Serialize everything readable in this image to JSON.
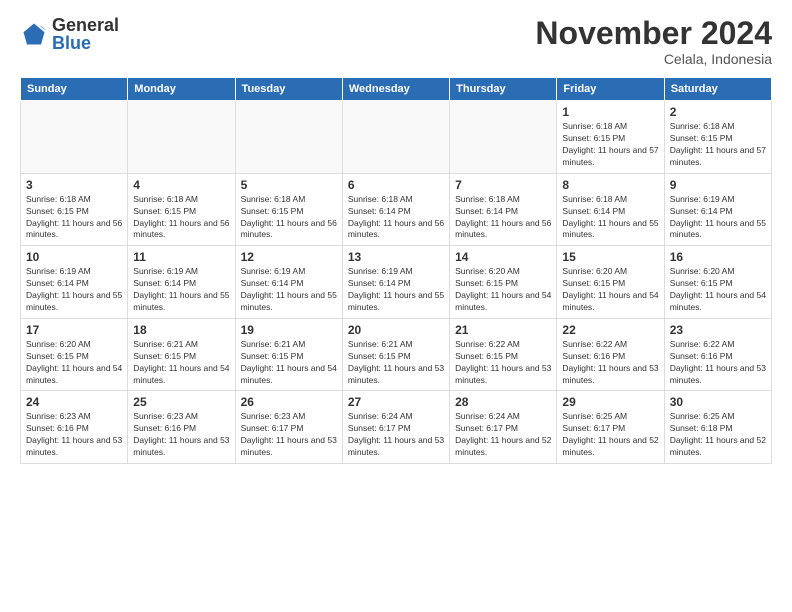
{
  "logo": {
    "general": "General",
    "blue": "Blue"
  },
  "title": "November 2024",
  "subtitle": "Celala, Indonesia",
  "days_of_week": [
    "Sunday",
    "Monday",
    "Tuesday",
    "Wednesday",
    "Thursday",
    "Friday",
    "Saturday"
  ],
  "weeks": [
    [
      {
        "day": "",
        "info": ""
      },
      {
        "day": "",
        "info": ""
      },
      {
        "day": "",
        "info": ""
      },
      {
        "day": "",
        "info": ""
      },
      {
        "day": "",
        "info": ""
      },
      {
        "day": "1",
        "info": "Sunrise: 6:18 AM\nSunset: 6:15 PM\nDaylight: 11 hours and 57 minutes."
      },
      {
        "day": "2",
        "info": "Sunrise: 6:18 AM\nSunset: 6:15 PM\nDaylight: 11 hours and 57 minutes."
      }
    ],
    [
      {
        "day": "3",
        "info": "Sunrise: 6:18 AM\nSunset: 6:15 PM\nDaylight: 11 hours and 56 minutes."
      },
      {
        "day": "4",
        "info": "Sunrise: 6:18 AM\nSunset: 6:15 PM\nDaylight: 11 hours and 56 minutes."
      },
      {
        "day": "5",
        "info": "Sunrise: 6:18 AM\nSunset: 6:15 PM\nDaylight: 11 hours and 56 minutes."
      },
      {
        "day": "6",
        "info": "Sunrise: 6:18 AM\nSunset: 6:14 PM\nDaylight: 11 hours and 56 minutes."
      },
      {
        "day": "7",
        "info": "Sunrise: 6:18 AM\nSunset: 6:14 PM\nDaylight: 11 hours and 56 minutes."
      },
      {
        "day": "8",
        "info": "Sunrise: 6:18 AM\nSunset: 6:14 PM\nDaylight: 11 hours and 55 minutes."
      },
      {
        "day": "9",
        "info": "Sunrise: 6:19 AM\nSunset: 6:14 PM\nDaylight: 11 hours and 55 minutes."
      }
    ],
    [
      {
        "day": "10",
        "info": "Sunrise: 6:19 AM\nSunset: 6:14 PM\nDaylight: 11 hours and 55 minutes."
      },
      {
        "day": "11",
        "info": "Sunrise: 6:19 AM\nSunset: 6:14 PM\nDaylight: 11 hours and 55 minutes."
      },
      {
        "day": "12",
        "info": "Sunrise: 6:19 AM\nSunset: 6:14 PM\nDaylight: 11 hours and 55 minutes."
      },
      {
        "day": "13",
        "info": "Sunrise: 6:19 AM\nSunset: 6:14 PM\nDaylight: 11 hours and 55 minutes."
      },
      {
        "day": "14",
        "info": "Sunrise: 6:20 AM\nSunset: 6:15 PM\nDaylight: 11 hours and 54 minutes."
      },
      {
        "day": "15",
        "info": "Sunrise: 6:20 AM\nSunset: 6:15 PM\nDaylight: 11 hours and 54 minutes."
      },
      {
        "day": "16",
        "info": "Sunrise: 6:20 AM\nSunset: 6:15 PM\nDaylight: 11 hours and 54 minutes."
      }
    ],
    [
      {
        "day": "17",
        "info": "Sunrise: 6:20 AM\nSunset: 6:15 PM\nDaylight: 11 hours and 54 minutes."
      },
      {
        "day": "18",
        "info": "Sunrise: 6:21 AM\nSunset: 6:15 PM\nDaylight: 11 hours and 54 minutes."
      },
      {
        "day": "19",
        "info": "Sunrise: 6:21 AM\nSunset: 6:15 PM\nDaylight: 11 hours and 54 minutes."
      },
      {
        "day": "20",
        "info": "Sunrise: 6:21 AM\nSunset: 6:15 PM\nDaylight: 11 hours and 53 minutes."
      },
      {
        "day": "21",
        "info": "Sunrise: 6:22 AM\nSunset: 6:15 PM\nDaylight: 11 hours and 53 minutes."
      },
      {
        "day": "22",
        "info": "Sunrise: 6:22 AM\nSunset: 6:16 PM\nDaylight: 11 hours and 53 minutes."
      },
      {
        "day": "23",
        "info": "Sunrise: 6:22 AM\nSunset: 6:16 PM\nDaylight: 11 hours and 53 minutes."
      }
    ],
    [
      {
        "day": "24",
        "info": "Sunrise: 6:23 AM\nSunset: 6:16 PM\nDaylight: 11 hours and 53 minutes."
      },
      {
        "day": "25",
        "info": "Sunrise: 6:23 AM\nSunset: 6:16 PM\nDaylight: 11 hours and 53 minutes."
      },
      {
        "day": "26",
        "info": "Sunrise: 6:23 AM\nSunset: 6:17 PM\nDaylight: 11 hours and 53 minutes."
      },
      {
        "day": "27",
        "info": "Sunrise: 6:24 AM\nSunset: 6:17 PM\nDaylight: 11 hours and 53 minutes."
      },
      {
        "day": "28",
        "info": "Sunrise: 6:24 AM\nSunset: 6:17 PM\nDaylight: 11 hours and 52 minutes."
      },
      {
        "day": "29",
        "info": "Sunrise: 6:25 AM\nSunset: 6:17 PM\nDaylight: 11 hours and 52 minutes."
      },
      {
        "day": "30",
        "info": "Sunrise: 6:25 AM\nSunset: 6:18 PM\nDaylight: 11 hours and 52 minutes."
      }
    ]
  ]
}
